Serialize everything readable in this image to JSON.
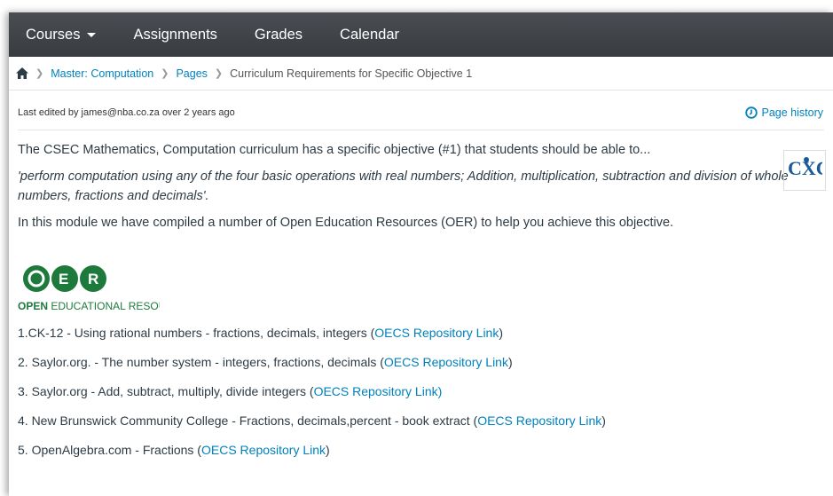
{
  "nav": {
    "courses": "Courses",
    "assignments": "Assignments",
    "grades": "Grades",
    "calendar": "Calendar"
  },
  "breadcrumb": {
    "home_icon": "home-icon",
    "course": "Master: Computation",
    "pages": "Pages",
    "current": "Curriculum Requirements for Specific Objective 1"
  },
  "meta": {
    "last_edited": "Last edited by james@nba.co.za over 2 years ago",
    "history_label": "Page history"
  },
  "body": {
    "intro": "The CSEC Mathematics, Computation curriculum has a specific objective (#1) that students should be able to...",
    "objective": "'perform computation using any of the four basic operations with real numbers; Addition, multiplication, subtraction and division of whole numbers, fractions and decimals'.",
    "module": "In this module we have compiled a number of Open Education Resources (OER) to help you achieve this objective."
  },
  "logos": {
    "cxc": "CXC",
    "oer_letters": [
      "O",
      "E",
      "R"
    ],
    "oer_caption_bold": "OPEN",
    "oer_caption_rest": " EDUCATIONAL RESOURCES"
  },
  "resources": [
    {
      "text": "1.CK-12 - Using rational numbers - fractions, decimals, integers (",
      "link": "OECS Repository Link",
      "suffix": ")"
    },
    {
      "text": "2. Saylor.org. - The number system - integers, fractions, decimals (",
      "link": "OECS Repository Link",
      "suffix": ")"
    },
    {
      "text": "3. Saylor.org - Add, subtract, multiply, divide integers (",
      "link": "OECS Repository Link)",
      "suffix": ""
    },
    {
      "text": "4. New Brunswick Community College - Fractions, decimals,percent - book extract (",
      "link": "OECS Repository Link",
      "suffix": ")"
    },
    {
      "text": "5. OpenAlgebra.com - Fractions (",
      "link": "OECS Repository Link",
      "suffix": ")"
    }
  ],
  "colors": {
    "nav_bg": "#3d4146",
    "link": "#0081bd",
    "oer_green": "#1e7a3c"
  }
}
